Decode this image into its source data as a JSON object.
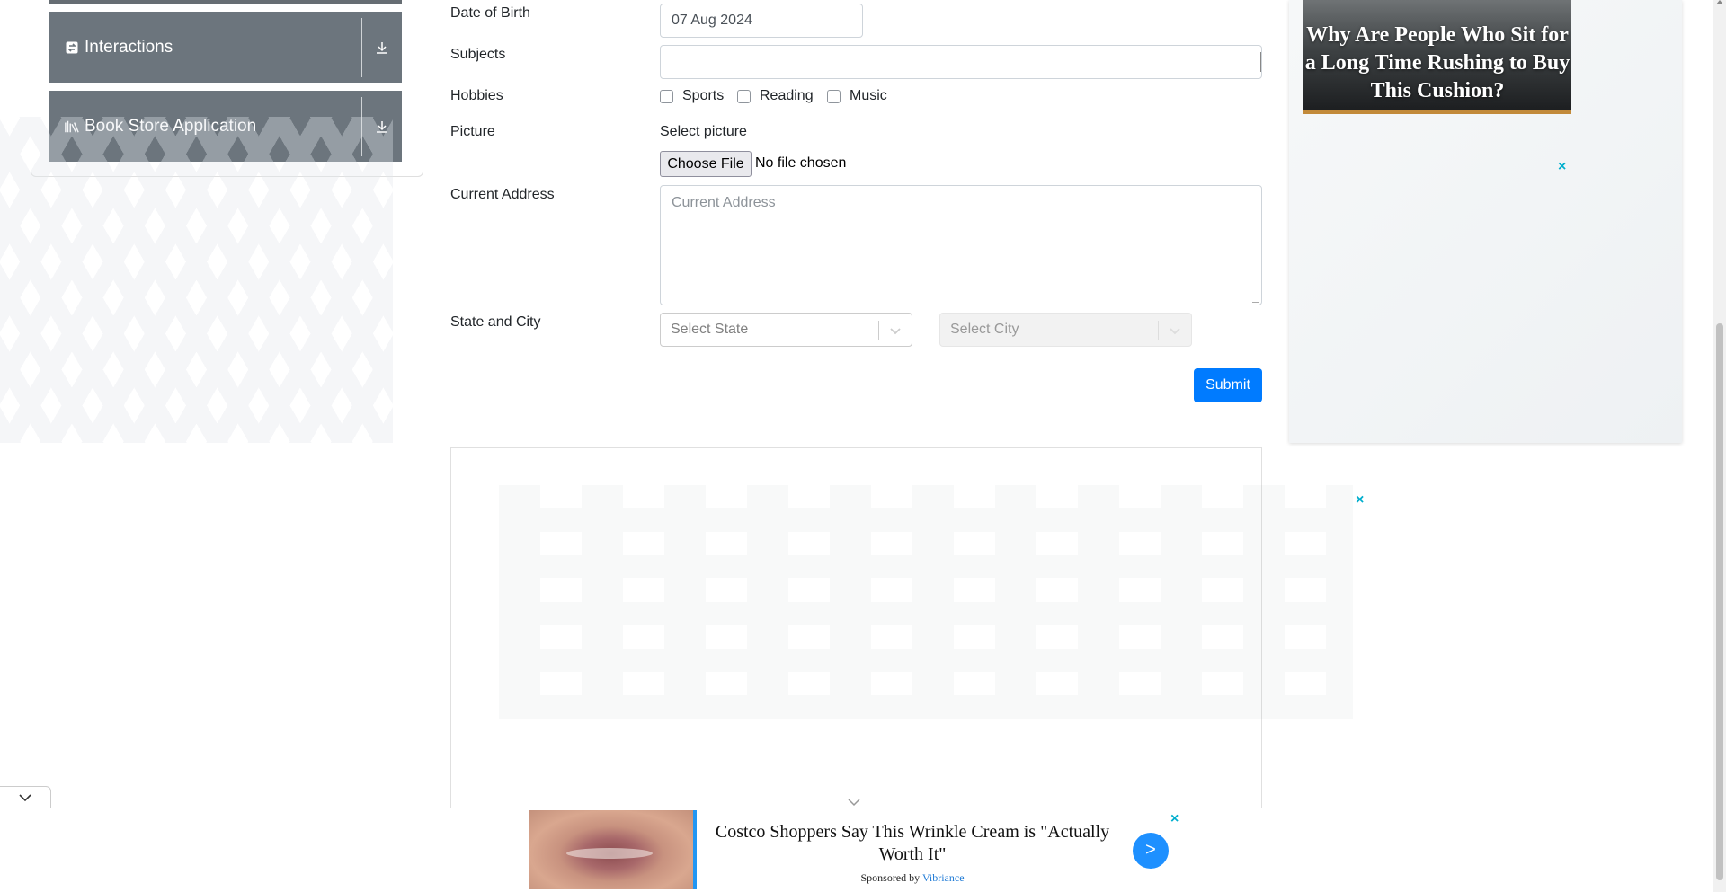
{
  "sidebar": {
    "groups": [
      {
        "label": "Interactions",
        "icon": "interactions-icon"
      },
      {
        "label": "Book Store Application",
        "icon": "book-store-icon"
      }
    ]
  },
  "form": {
    "dob": {
      "label": "Date of Birth",
      "value": "07 Aug 2024"
    },
    "subjects": {
      "label": "Subjects",
      "value": ""
    },
    "hobbies": {
      "label": "Hobbies",
      "options": [
        {
          "label": "Sports",
          "checked": false
        },
        {
          "label": "Reading",
          "checked": false
        },
        {
          "label": "Music",
          "checked": false
        }
      ]
    },
    "picture": {
      "label": "Picture",
      "select_text": "Select picture",
      "button_label": "Choose File",
      "status": "No file chosen"
    },
    "address": {
      "label": "Current Address",
      "placeholder": "Current Address"
    },
    "state_city": {
      "label": "State and City",
      "state_placeholder": "Select State",
      "city_placeholder": "Select City"
    },
    "submit_label": "Submit"
  },
  "right_ad": {
    "headline": "Why Are People Who Sit for a Long Time Rushing to Buy This Cushion?",
    "close": "×"
  },
  "middle_ad": {
    "close": "×"
  },
  "bottom_ad": {
    "title": "Costco Shoppers Say This Wrinkle Cream is \"Actually Worth It\"",
    "sponsor_prefix": "Sponsored by",
    "sponsor_brand": "Vibriance",
    "arrow": ">",
    "close": "×"
  },
  "colors": {
    "primary": "#007bff",
    "sidebar_group": "#6c757d",
    "ad_close": "#00aecd"
  }
}
